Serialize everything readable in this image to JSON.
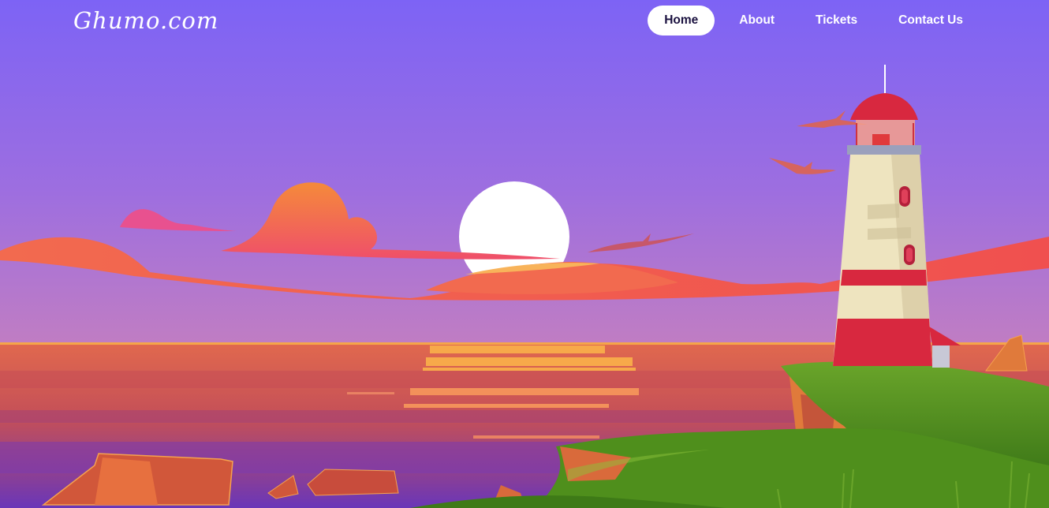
{
  "site": {
    "logo": "Ghumo.com"
  },
  "nav": {
    "items": [
      {
        "label": "Home",
        "active": true
      },
      {
        "label": "About",
        "active": false
      },
      {
        "label": "Tickets",
        "active": false
      },
      {
        "label": "Contact Us",
        "active": false
      }
    ]
  },
  "colors": {
    "sky_top": "#7e63f4",
    "sky_horizon": "#b777cc",
    "cloud": "#f26b4a",
    "sun": "#ffffff",
    "sea": "#d4554c",
    "grass": "#4e8e1c",
    "lighthouse_red": "#d8283f",
    "lighthouse_cream": "#eee4bf",
    "nav_active_bg": "#ffffff"
  }
}
